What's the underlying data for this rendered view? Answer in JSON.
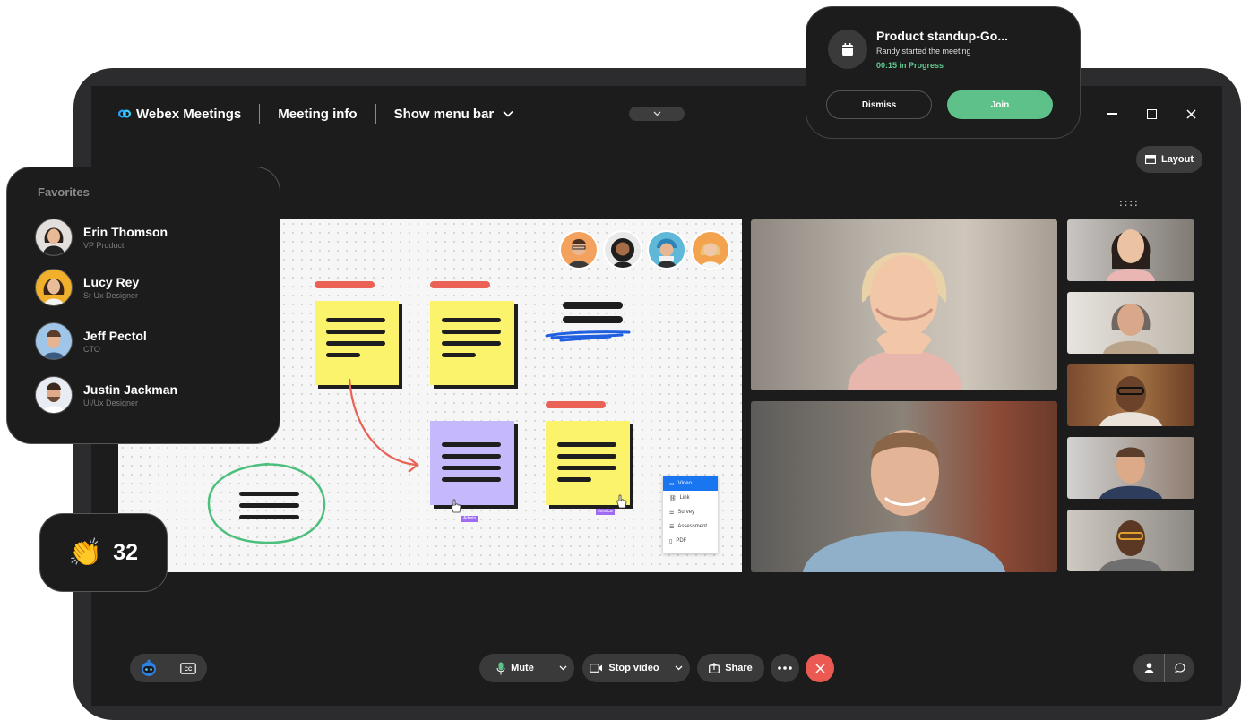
{
  "window": {
    "app_name": "Webex Meetings",
    "meeting_info": "Meeting info",
    "show_menu_bar": "Show menu bar"
  },
  "layout_button": {
    "label": "Layout"
  },
  "notification": {
    "title": "Product standup-Go...",
    "subtitle": "Randy started the meeting",
    "status": "00:15 in Progress",
    "dismiss_label": "Dismiss",
    "join_label": "Join"
  },
  "favorites": {
    "title": "Favorites",
    "people": [
      {
        "name": "Erin Thomson",
        "role": "VP Product"
      },
      {
        "name": "Lucy Rey",
        "role": "Sr Ux Designer"
      },
      {
        "name": "Jeff Pectol",
        "role": "CTO"
      },
      {
        "name": "Justin Jackman",
        "role": "UI/Ux Designer"
      }
    ]
  },
  "reactions": {
    "count": "32"
  },
  "whiteboard": {
    "cursor_labels": [
      "Admin",
      "Jessica"
    ],
    "menu": [
      "Video",
      "Link",
      "Survey",
      "Assessment",
      "PDF"
    ]
  },
  "controls": {
    "mute": "Mute",
    "stop_video": "Stop video",
    "share": "Share"
  },
  "colors": {
    "sticky_yellow": "#fbf36b",
    "sticky_purple": "#c5b8fb",
    "tag_red": "#ea6256",
    "join_green": "#5fc18a",
    "end_red": "#ea5a52",
    "menu_blue": "#1976f0"
  }
}
